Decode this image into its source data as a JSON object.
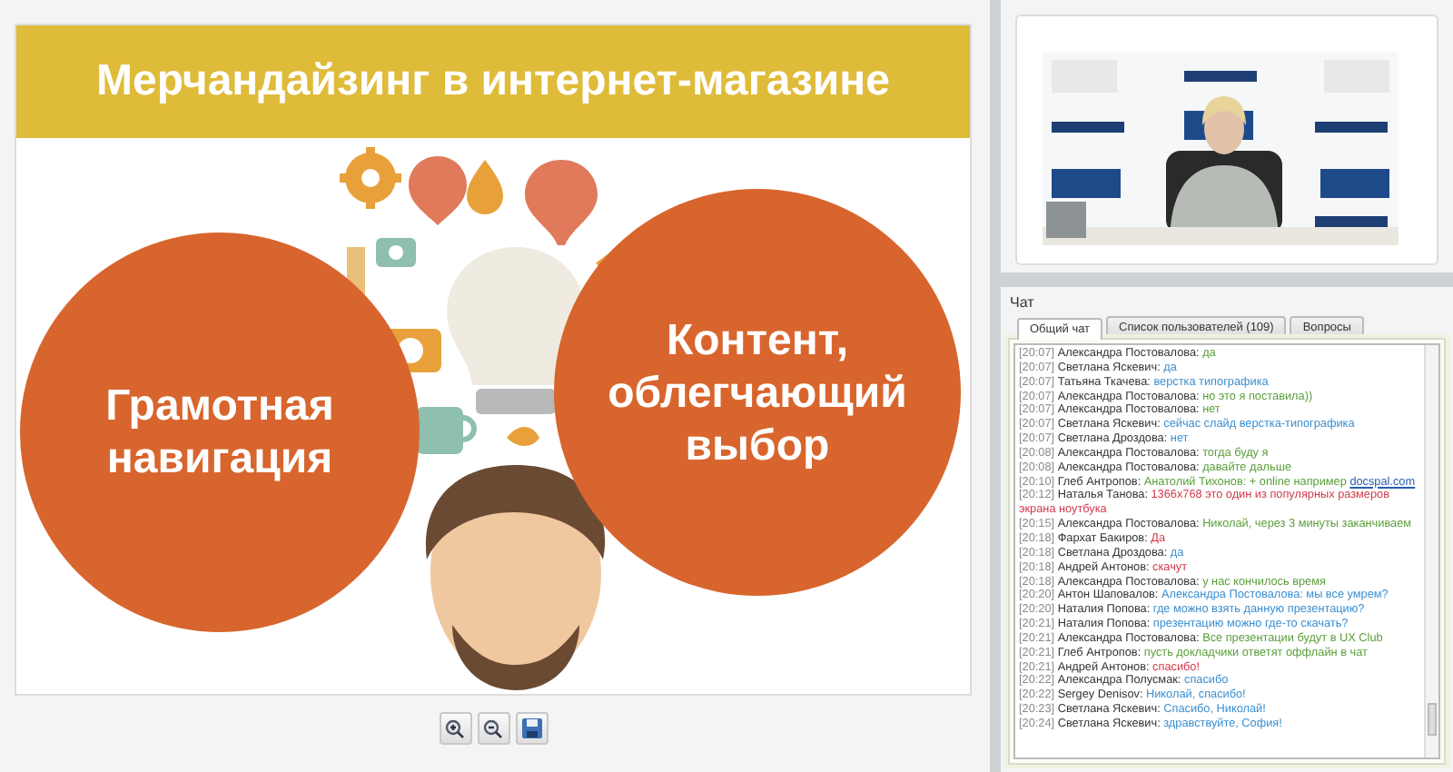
{
  "presentation": {
    "slide": {
      "title": "Мерчандайзинг в интернет-магазине",
      "topics": [
        "Грамотная навигация",
        "Контент, облегчающий выбор"
      ]
    },
    "toolbar": [
      {
        "kind": "zoom-in"
      },
      {
        "kind": "zoom-out"
      },
      {
        "kind": "save"
      }
    ]
  },
  "chat": {
    "title": "Чат",
    "tabs": [
      {
        "label": "Общий чат",
        "selected": true
      },
      {
        "label": "Список пользователей (109)",
        "selected": false
      },
      {
        "label": "Вопросы",
        "selected": false
      }
    ],
    "messages": [
      {
        "time": "[20:07]",
        "author": "Александра Постовалова:",
        "text": "да",
        "color": "#5a9e3a"
      },
      {
        "time": "[20:07]",
        "author": "Светлана Яскевич:",
        "text": "да",
        "color": "#3a8ed0"
      },
      {
        "time": "[20:07]",
        "author": "Татьяна Ткачева:",
        "text": "верстка типографика",
        "color": "#3a8ed0"
      },
      {
        "time": "[20:07]",
        "author": "Александра Постовалова:",
        "text": "но это я поставила))",
        "color": "#5a9e3a"
      },
      {
        "time": "[20:07]",
        "author": "Александра Постовалова:",
        "text": "нет",
        "color": "#5a9e3a"
      },
      {
        "time": "[20:07]",
        "author": "Светлана Яскевич:",
        "text": "сейчас слайд верстка-типографика",
        "color": "#3a8ed0"
      },
      {
        "time": "[20:07]",
        "author": "Светлана Дроздова:",
        "text": "нет",
        "color": "#3a8ed0"
      },
      {
        "time": "[20:08]",
        "author": "Александра Постовалова:",
        "text": "тогда буду я",
        "color": "#5a9e3a"
      },
      {
        "time": "[20:08]",
        "author": "Александра Постовалова:",
        "text": "давайте дальше",
        "color": "#5a9e3a"
      },
      {
        "time": "[20:10]",
        "author": "Глеб Антропов:",
        "text": "Анатолий Тихонов: + online например",
        "link": "docspal.com",
        "color": "#5a9e3a"
      },
      {
        "time": "[20:12]",
        "author": "Наталья Танова:",
        "text": "1366x768 это один из популярных размеров экрана ноутбука",
        "color": "#d03a4a"
      },
      {
        "time": "[20:15]",
        "author": "Александра Постовалова:",
        "text": "Николай, через 3 минуты заканчиваем",
        "color": "#5a9e3a"
      },
      {
        "time": "[20:18]",
        "author": "Фархат Бакиров:",
        "text": "Да",
        "color": "#d03a4a"
      },
      {
        "time": "[20:18]",
        "author": "Светлана Дроздова:",
        "text": "да",
        "color": "#3a8ed0"
      },
      {
        "time": "[20:18]",
        "author": "Андрей Антонов:",
        "text": "скачут",
        "color": "#d03a4a"
      },
      {
        "time": "[20:18]",
        "author": "Александра Постовалова:",
        "text": "у нас кончилось время",
        "color": "#5a9e3a"
      },
      {
        "time": "[20:20]",
        "author": "Антон Шаповалов:",
        "text": "Александра Постовалова: мы все умрем?",
        "color": "#3a8ed0"
      },
      {
        "time": "[20:20]",
        "author": "Наталия Попова:",
        "text": "где можно взять данную презентацию?",
        "color": "#3a8ed0"
      },
      {
        "time": "[20:21]",
        "author": "Наталия Попова:",
        "text": "презентацию можно где-то скачать?",
        "color": "#3a8ed0"
      },
      {
        "time": "[20:21]",
        "author": "Александра Постовалова:",
        "text": "Все презентации будут в UX Club",
        "color": "#5a9e3a"
      },
      {
        "time": "[20:21]",
        "author": "Глеб Антропов:",
        "text": "пусть докладчики ответят оффлайн в чат",
        "color": "#5a9e3a"
      },
      {
        "time": "[20:21]",
        "author": "Андрей Антонов:",
        "text": "спасибо!",
        "color": "#d03a4a"
      },
      {
        "time": "[20:22]",
        "author": "Александра Полусмак:",
        "text": "спасибо",
        "color": "#3a8ed0"
      },
      {
        "time": "[20:22]",
        "author": "Sergey Denisov:",
        "text": "Николай, спасибо!",
        "color": "#3a8ed0"
      },
      {
        "time": "[20:23]",
        "author": "Светлана Яскевич:",
        "text": "Спасибо, Николай!",
        "color": "#3a8ed0"
      },
      {
        "time": "[20:24]",
        "author": "Светлана Яскевич:",
        "text": "здравствуйте, София!",
        "color": "#3a8ed0"
      }
    ]
  }
}
